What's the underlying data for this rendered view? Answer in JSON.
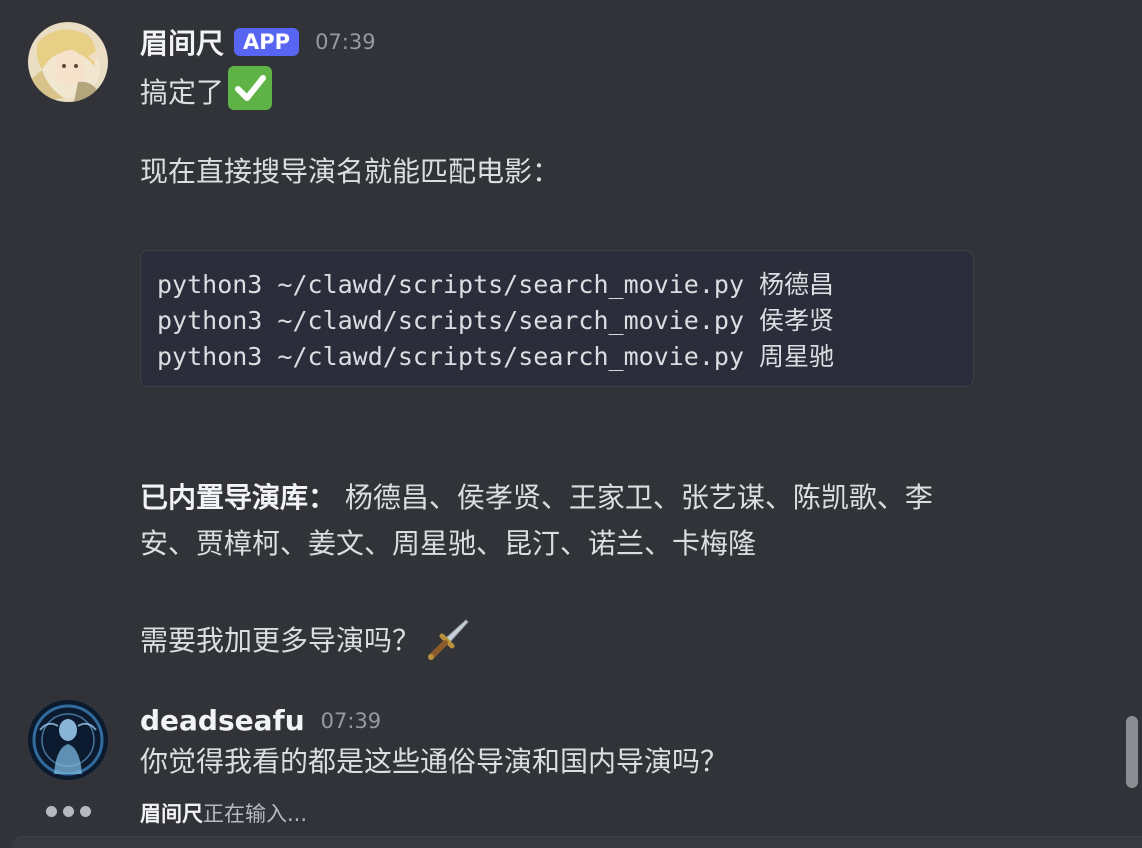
{
  "messages": [
    {
      "author": "眉间尺",
      "badge": "APP",
      "time": "07:39",
      "line1": "搞定了",
      "emoji1": "check-mark",
      "line2": "现在直接搜导演名就能匹配电影：",
      "code": [
        "python3 ~/clawd/scripts/search_movie.py 杨德昌",
        "python3 ~/clawd/scripts/search_movie.py 侯孝贤",
        "python3 ~/clawd/scripts/search_movie.py 周星驰"
      ],
      "list_label": "已内置导演库：",
      "list_line1": " 杨德昌、侯孝贤、王家卫、张艺谋、陈凯歌、李",
      "list_line2": "安、贾樟柯、姜文、周星驰、昆汀、诺兰、卡梅隆",
      "question": "需要我加更多导演吗？",
      "emoji2": "dagger"
    },
    {
      "author": "deadseafu",
      "time": "07:39",
      "text": "你觉得我看的都是这些通俗导演和国内导演吗？"
    }
  ],
  "typing": {
    "name": "眉间尺",
    "suffix": "正在输入..."
  },
  "colors": {
    "background": "#313338",
    "badge": "#5865f2",
    "check": "#5fb346"
  }
}
